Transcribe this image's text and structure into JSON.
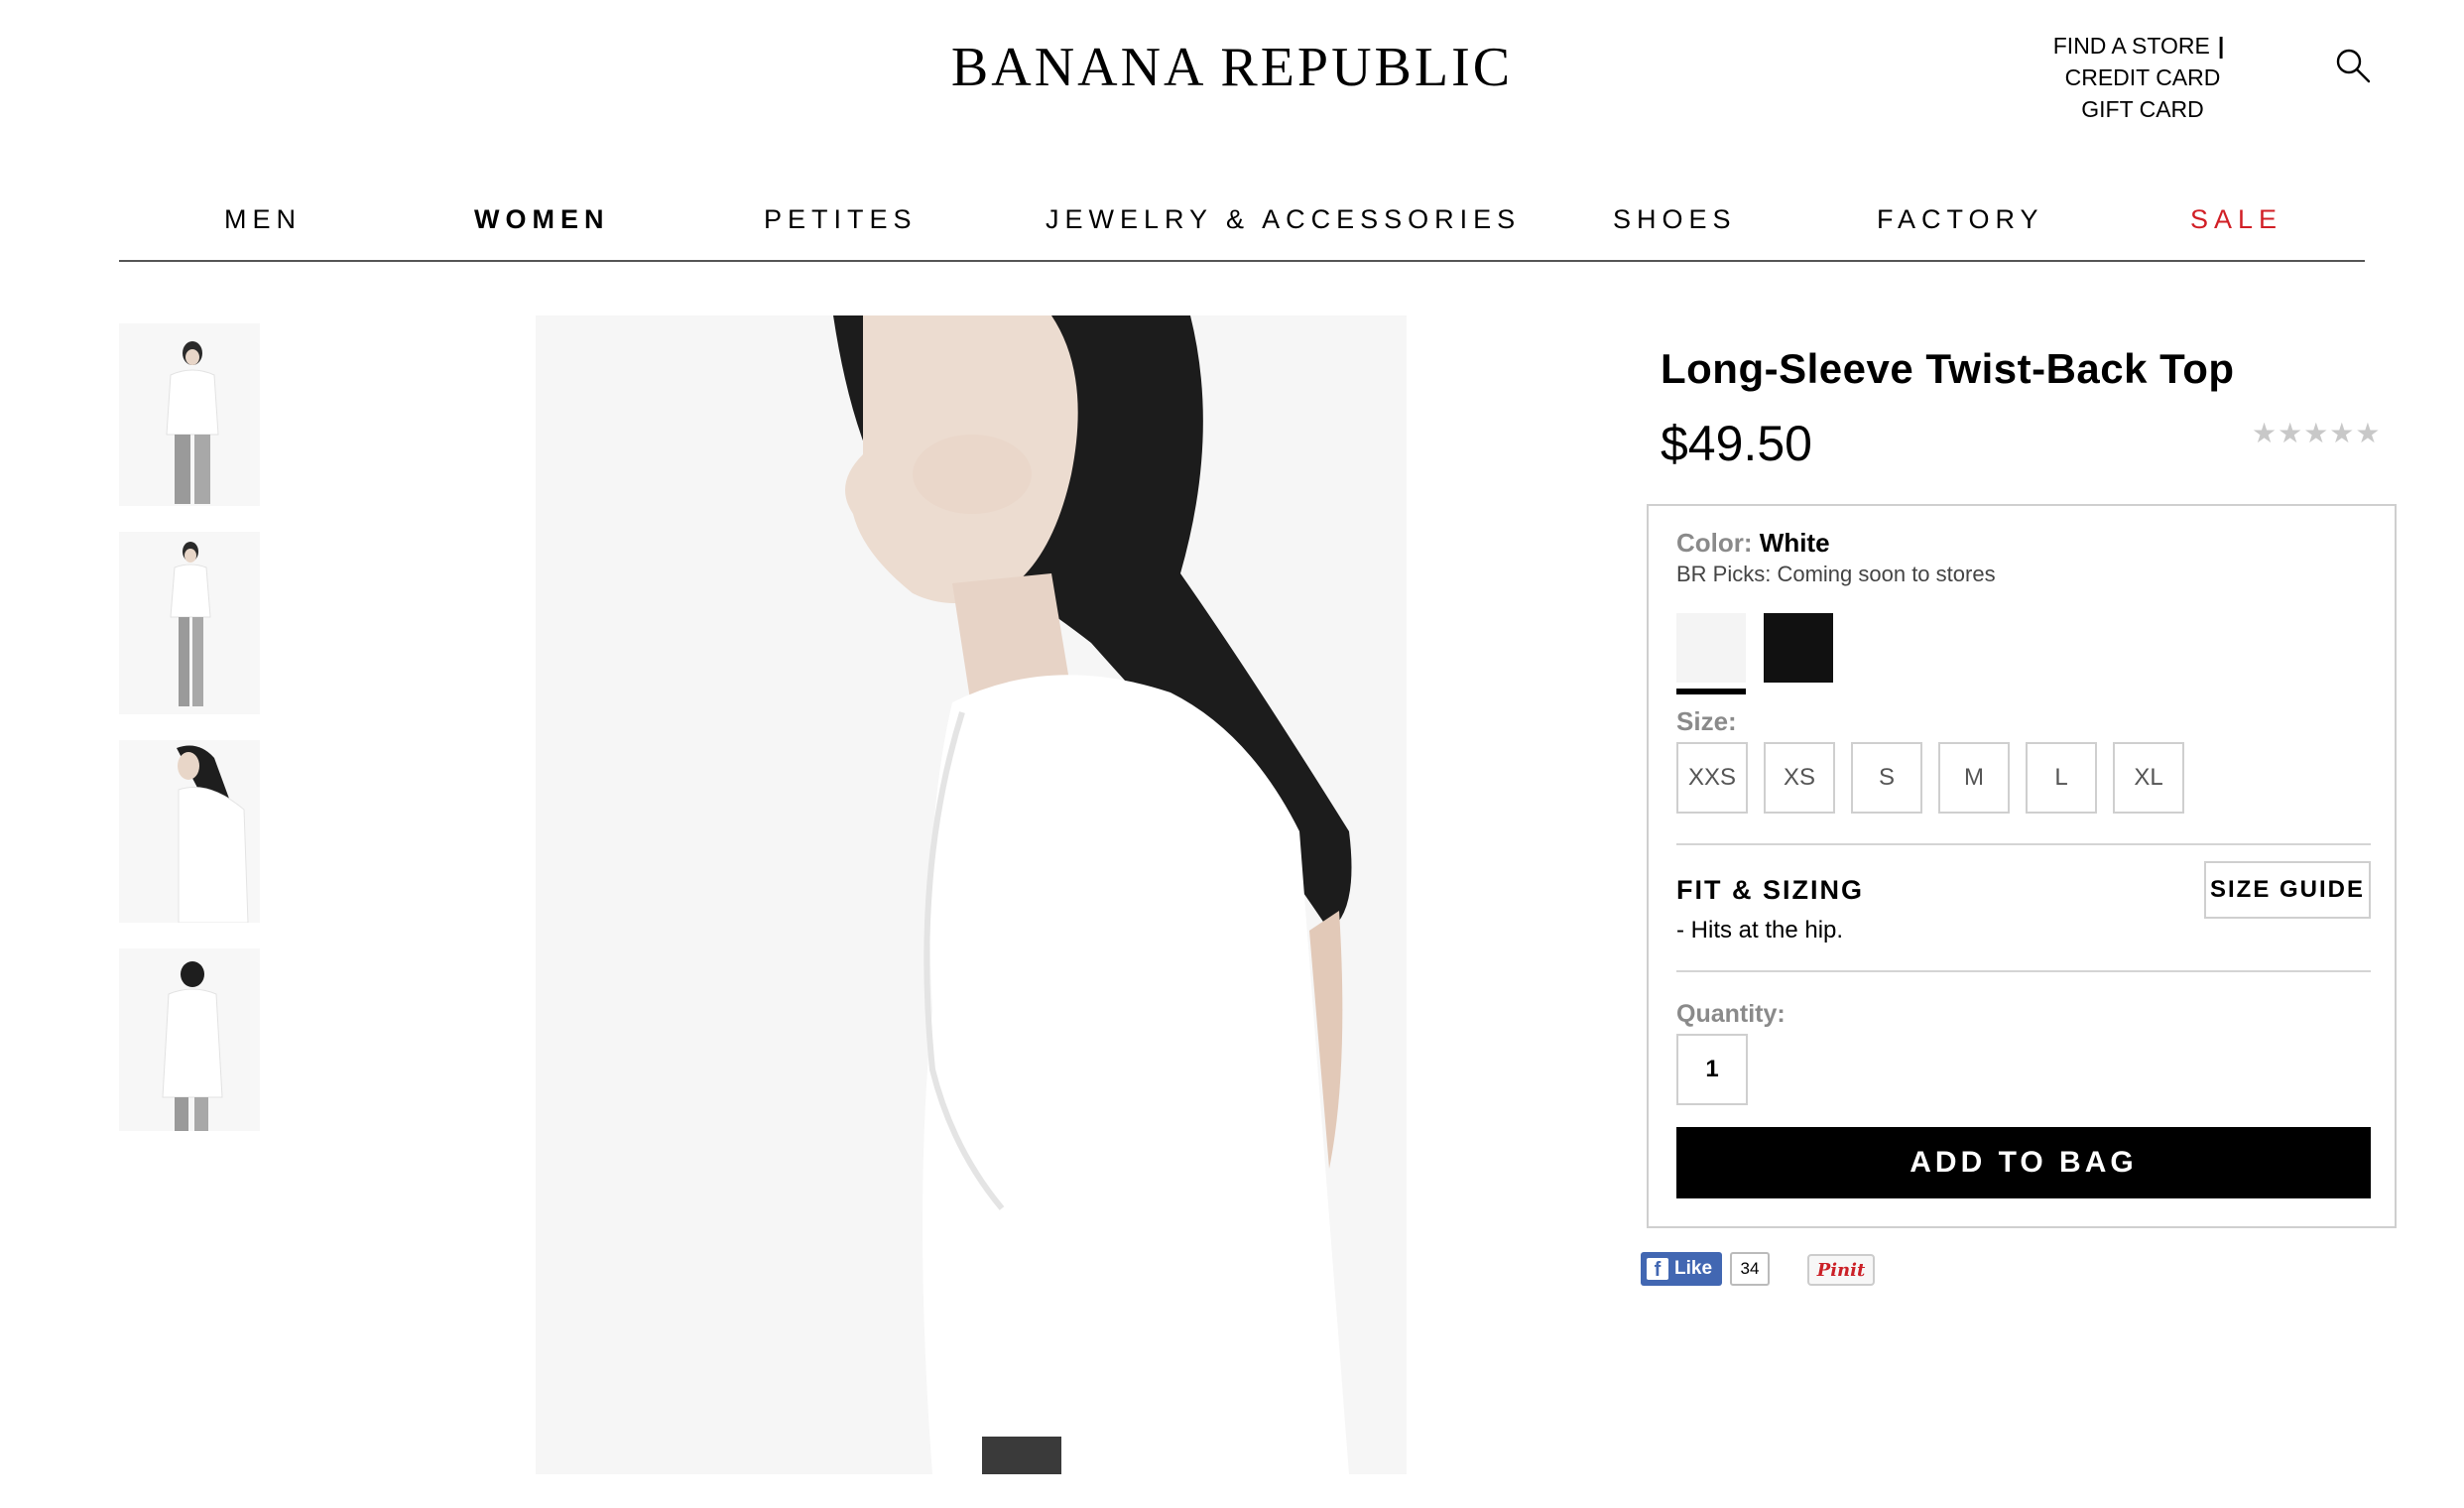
{
  "header": {
    "brand": "BANANA REPUBLIC",
    "find_store": "FIND A STORE",
    "divider": "|",
    "credit_card": "CREDIT CARD",
    "gift_card": "GIFT CARD",
    "search_icon": "search-icon"
  },
  "nav": {
    "items": [
      {
        "label": "MEN"
      },
      {
        "label": "WOMEN",
        "active": true
      },
      {
        "label": "PETITES"
      },
      {
        "label": "JEWELRY & ACCESSORIES"
      },
      {
        "label": "SHOES"
      },
      {
        "label": "FACTORY"
      },
      {
        "label": "SALE",
        "color": "#d11f26"
      }
    ]
  },
  "product": {
    "title": "Long-Sleeve Twist-Back Top",
    "price": "$49.50",
    "rating_stars": "★★★★★",
    "color_label": "Color:",
    "color_value": "White",
    "br_picks": "BR Picks: Coming soon to stores",
    "swatches": [
      {
        "name": "White",
        "color": "#f4f4f4",
        "selected": true
      },
      {
        "name": "Black",
        "color": "#111111",
        "selected": false
      }
    ],
    "size_label": "Size:",
    "sizes": [
      "XXS",
      "XS",
      "S",
      "M",
      "L",
      "XL"
    ],
    "fit_title": "FIT & SIZING",
    "fit_desc": "-  Hits at the hip.",
    "size_guide": "SIZE GUIDE",
    "quantity_label": "Quantity:",
    "quantity_value": "1",
    "add_to_bag": "ADD TO BAG"
  },
  "social": {
    "fb_like": "Like",
    "fb_count": "34",
    "pin": "Pinit"
  },
  "colors": {
    "sale": "#d11f26",
    "facebook": "#4267b2",
    "pinterest": "#cb2027"
  }
}
